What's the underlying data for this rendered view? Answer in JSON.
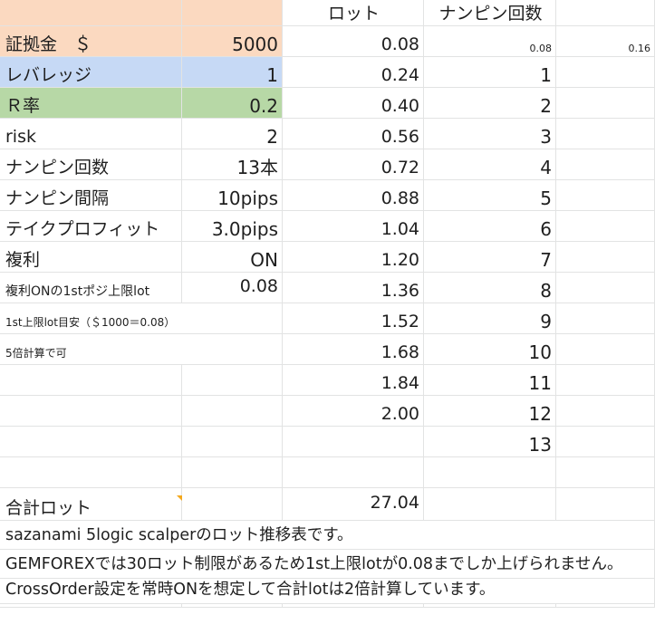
{
  "header": {
    "lot_label": "ロット",
    "nanpin_count_label": "ナンピン回数"
  },
  "params": [
    {
      "label": "証拠金　＄",
      "value": "5000",
      "color": "#fbd9c0"
    },
    {
      "label": "レバレッジ",
      "value": "1",
      "color": "#c6d9f5"
    },
    {
      "label": "Ｒ率",
      "value": "0.2",
      "color": "#b7d8a6"
    },
    {
      "label": "risk",
      "value": "2"
    },
    {
      "label": "ナンピン回数",
      "value": "13本"
    },
    {
      "label": "ナンピン間隔",
      "value": "10pips"
    },
    {
      "label": "テイクプロフィット",
      "value": "3.0pips"
    },
    {
      "label": "複利",
      "value": "ON"
    },
    {
      "label": "複利ONの1stポジ上限lot",
      "value": "0.08"
    }
  ],
  "notes_small": [
    "1st上限lot目安（＄1000＝0.08）",
    "5倍計算で可"
  ],
  "row1_extra": {
    "nanpin_value": "0.08",
    "extra_value": "0.16"
  },
  "lots": [
    "0.08",
    "0.24",
    "0.40",
    "0.56",
    "0.72",
    "0.88",
    "1.04",
    "1.20",
    "1.36",
    "1.52",
    "1.68",
    "1.84",
    "2.00"
  ],
  "nanpin_counts": [
    "1",
    "2",
    "3",
    "4",
    "5",
    "6",
    "7",
    "8",
    "9",
    "10",
    "11",
    "12",
    "13"
  ],
  "total": {
    "label": "合計ロット",
    "value": "27.04"
  },
  "footer_notes": [
    "sazanami 5logic scalperのロット推移表です。",
    "GEMFOREXでは30ロット制限があるため1st上限lotが0.08までしか上げられません。",
    "CrossOrder設定を常時ONを想定して合計lotは2倍計算しています。"
  ]
}
